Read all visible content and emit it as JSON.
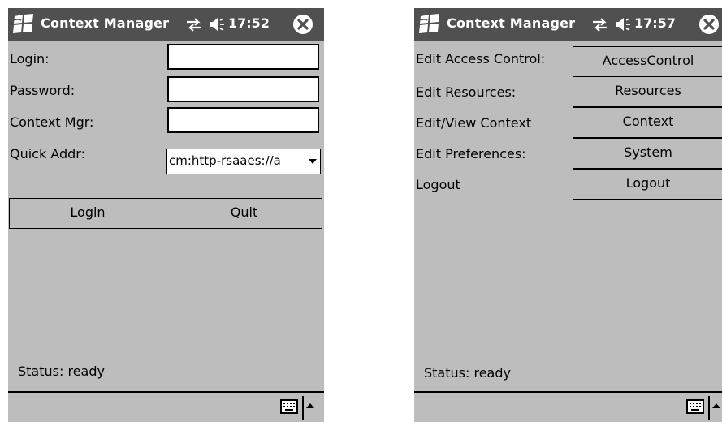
{
  "left_screen": {
    "titlebar": {
      "title": "Context Manager",
      "clock": "17:52"
    },
    "form": {
      "login_label": "Login:",
      "login_value": "",
      "password_label": "Password:",
      "password_value": "",
      "context_mgr_label": "Context Mgr:",
      "context_mgr_value": "",
      "quick_addr_label": "Quick Addr:",
      "quick_addr_value": "cm:http-rsaaes://a"
    },
    "buttons": {
      "login": "Login",
      "quit": "Quit"
    },
    "status": "Status: ready"
  },
  "right_screen": {
    "titlebar": {
      "title": "Context Manager",
      "clock": "17:57"
    },
    "menu": [
      {
        "label": "Edit Access Control:",
        "button": "AccessControl"
      },
      {
        "label": "Edit Resources:",
        "button": "Resources"
      },
      {
        "label": "Edit/View Context",
        "button": "Context"
      },
      {
        "label": "Edit Preferences:",
        "button": "System"
      },
      {
        "label": "Logout",
        "button": "Logout"
      }
    ],
    "status": "Status: ready"
  },
  "icons": {
    "start": "windows-flag-icon",
    "connectivity": "connectivity-arrows-icon",
    "volume": "speaker-icon",
    "close": "close-icon",
    "keyboard": "keyboard-icon",
    "sip_toggle": "chevron-up-icon"
  },
  "colors": {
    "titlebar_bg": "#505050",
    "screen_bg": "#bdbdbd",
    "text": "#000000"
  }
}
